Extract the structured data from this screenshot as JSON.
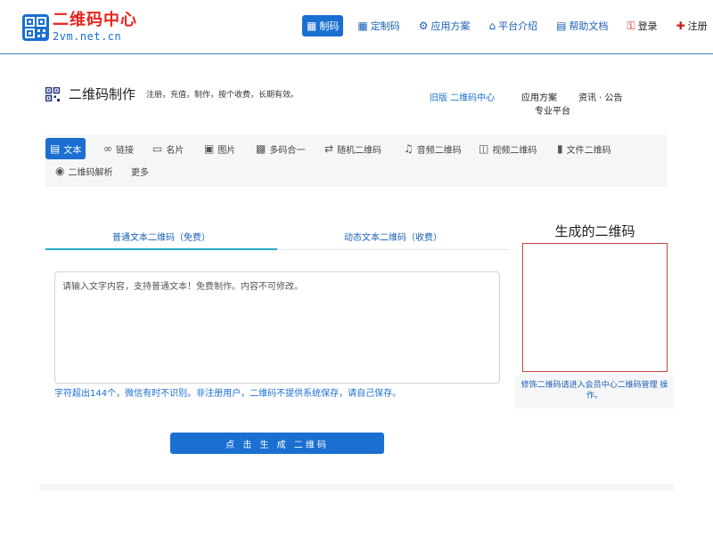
{
  "header": {
    "logo_title": "二维码中心",
    "logo_url": "2vm.net.cn",
    "nav": [
      {
        "label": "制码",
        "icon": "qrcode-icon"
      },
      {
        "label": "定制码",
        "icon": "grid-icon"
      },
      {
        "label": "应用方案",
        "icon": "gears-icon"
      },
      {
        "label": "平台介绍",
        "icon": "home-icon"
      },
      {
        "label": "帮助文档",
        "icon": "document-icon"
      },
      {
        "label": "登录",
        "icon": "key-icon"
      },
      {
        "label": "注册",
        "icon": "user-plus-icon"
      }
    ]
  },
  "title": {
    "text": "二维码制作",
    "subtitle": "注册，充值，制作，按个收费，长期有效。"
  },
  "top_links": {
    "old": "旧版 二维码中心",
    "app": "应用方案",
    "news": "资讯 · 公告",
    "pro": "专业平台"
  },
  "tabs": [
    {
      "label": "文本",
      "icon": "file-text-icon"
    },
    {
      "label": "链接",
      "icon": "link-icon"
    },
    {
      "label": "名片",
      "icon": "card-icon"
    },
    {
      "label": "图片",
      "icon": "image-icon"
    },
    {
      "label": "多码合一",
      "icon": "multi-qr-icon"
    },
    {
      "label": "随机二维码",
      "icon": "random-icon"
    },
    {
      "label": "音频二维码",
      "icon": "music-icon"
    },
    {
      "label": "视频二维码",
      "icon": "film-icon"
    },
    {
      "label": "文件二维码",
      "icon": "file-icon"
    },
    {
      "label": "二维码解析",
      "icon": "eye-icon"
    },
    {
      "label": "更多",
      "icon": ""
    }
  ],
  "subtabs": [
    {
      "label": "普通文本二维码（免费）"
    },
    {
      "label": "动态文本二维码（收费）"
    }
  ],
  "form": {
    "placeholder": "请输入文字内容，支持普通文本！免费制作。内容不可修改。",
    "hint": "字符超出144个，微信有时不识别。非注册用户，二维码不提供系统保存，请自己保存。",
    "button": "点 击 生 成 二维码"
  },
  "result": {
    "title": "生成的二维码",
    "note": "修饰二维码请进入会员中心二维码管理 操作。"
  },
  "colors": {
    "primary": "#1a6fd1",
    "logo_red": "#e8231d",
    "qr_border": "#c0483d"
  }
}
